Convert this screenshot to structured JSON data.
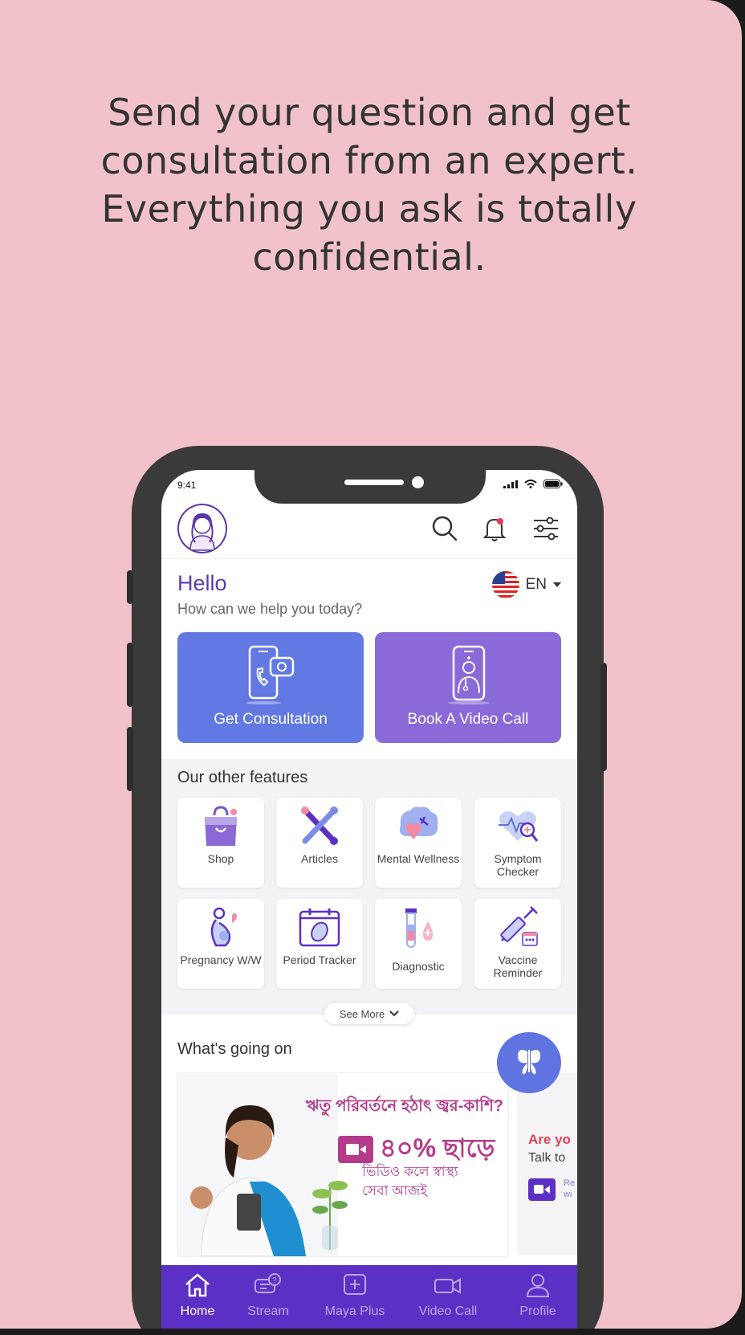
{
  "headline": "Send your question and get consultation from an expert. Everything you ask is totally confidential.",
  "status": {
    "time": "9:41"
  },
  "greeting": {
    "hello": "Hello",
    "subtitle": "How can we help you today?",
    "language": "EN"
  },
  "actions": [
    {
      "label": "Get Consultation",
      "color": "#6278e2"
    },
    {
      "label": "Book A Video Call",
      "color": "#8a6ad8"
    }
  ],
  "features": {
    "title": "Our other features",
    "items": [
      {
        "label": "Shop",
        "icon": "shopping-bag-icon"
      },
      {
        "label": "Articles",
        "icon": "articles-icon"
      },
      {
        "label": "Mental Wellness",
        "icon": "brain-heart-icon"
      },
      {
        "label": "Symptom Checker",
        "icon": "heart-magnifier-icon"
      },
      {
        "label": "Pregnancy W/W",
        "icon": "pregnancy-icon"
      },
      {
        "label": "Period Tracker",
        "icon": "calendar-pad-icon"
      },
      {
        "label": "Diagnostic",
        "icon": "test-tube-icon"
      },
      {
        "label": "Vaccine Reminder",
        "icon": "syringe-icon"
      }
    ],
    "see_more": "See More"
  },
  "whats_going_on": {
    "title": "What's going on",
    "banner": {
      "headline": "ঋতু পরিবর্তনে হঠাৎ জ্বর-কাশি?",
      "discount": "৪০% ছাড়ে",
      "line1": "ভিডিও কলে স্বাস্থ্য",
      "line2": "সেবা আজই"
    },
    "banner2": {
      "title": "Are yo",
      "subtitle": "Talk to",
      "small1": "Re",
      "small2": "wi"
    }
  },
  "bottom_nav": [
    {
      "label": "Home",
      "icon": "home-icon",
      "active": true
    },
    {
      "label": "Stream",
      "icon": "chat-question-icon",
      "active": false
    },
    {
      "label": "Maya Plus",
      "icon": "plus-square-icon",
      "active": false
    },
    {
      "label": "Video Call",
      "icon": "video-camera-icon",
      "active": false
    },
    {
      "label": "Profile",
      "icon": "user-icon",
      "active": false
    }
  ],
  "colors": {
    "background": "#f2c2ca",
    "brand_purple": "#5c30c4",
    "accent_blue": "#6278e2"
  }
}
